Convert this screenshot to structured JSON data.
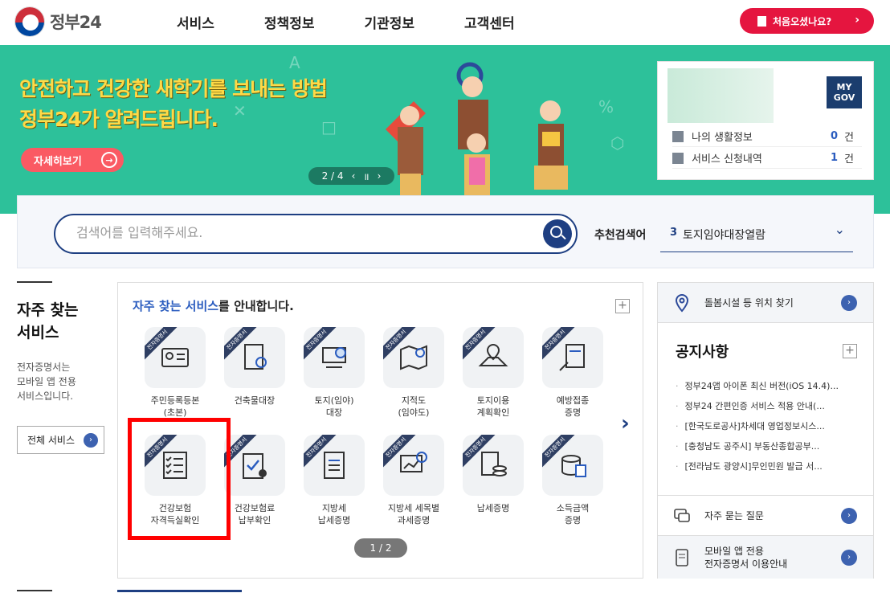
{
  "header": {
    "logo_text": "정부24",
    "nav": [
      "서비스",
      "정책정보",
      "기관정보",
      "고객센터"
    ],
    "first_visit_label": "처음오셨나요?"
  },
  "banner": {
    "title_line1": "안전하고 건강한 새학기를 보내는 방법",
    "title_line2": "정부24가 알려드립니다.",
    "detail_label": "자세히보기",
    "pager": "2 / 4"
  },
  "mygov": {
    "badge_line1": "MY",
    "badge_line2": "GOV",
    "rows": [
      {
        "label": "나의 생활정보",
        "count": "0",
        "unit": "건"
      },
      {
        "label": "서비스 신청내역",
        "count": "1",
        "unit": "건"
      }
    ]
  },
  "search": {
    "placeholder": "검색어를 입력해주세요.",
    "recommend_label": "추천검색어",
    "recommend_num": "3",
    "recommend_keyword": "토지임야대장열람"
  },
  "left": {
    "heading_line1": "자주 찾는",
    "heading_line2": "서비스",
    "desc_line1": "전자증명서는",
    "desc_line2": "모바일 앱 전용",
    "desc_line3": "서비스입니다.",
    "all_label": "전체 서비스"
  },
  "services": {
    "title_highlight": "자주 찾는 서비스",
    "title_rest": "를 안내합니다.",
    "ribbon": "전자증명서",
    "items": [
      {
        "l1": "주민등록등본",
        "l2": "(초본)"
      },
      {
        "l1": "건축물대장",
        "l2": ""
      },
      {
        "l1": "토지(임야)",
        "l2": "대장"
      },
      {
        "l1": "지적도",
        "l2": "(임야도)"
      },
      {
        "l1": "토지이용",
        "l2": "계획확인"
      },
      {
        "l1": "예방접종",
        "l2": "증명"
      },
      {
        "l1": "건강보험",
        "l2": "자격득실확인"
      },
      {
        "l1": "건강보험료",
        "l2": "납부확인"
      },
      {
        "l1": "지방세",
        "l2": "납세증명"
      },
      {
        "l1": "지방세 세목별",
        "l2": "과세증명"
      },
      {
        "l1": "납세증명",
        "l2": ""
      },
      {
        "l1": "소득금액",
        "l2": "증명"
      }
    ],
    "page": "1 / 2"
  },
  "right": {
    "care_label": "돌봄시설 등 위치 찾기",
    "notice_heading": "공지사항",
    "notices": [
      "정부24앱 아이폰 최신 버전(iOS 14.4)...",
      "정부24 간편인증 서비스 적용 안내(...",
      "[한국도로공사]차세대 영업정보시스...",
      "[충청남도 공주시] 부동산종합공부...",
      "[전라남도 광양시]무인민원 발급 서..."
    ],
    "faq_label": "자주 묻는 질문",
    "mobile_line1": "모바일 앱 전용",
    "mobile_line2": "전자증명서 이용안내"
  },
  "colors": {
    "brand_navy": "#1e3f82",
    "banner_green": "#2dc19a",
    "accent_red": "#e5153f",
    "highlight": "#ff0000"
  }
}
